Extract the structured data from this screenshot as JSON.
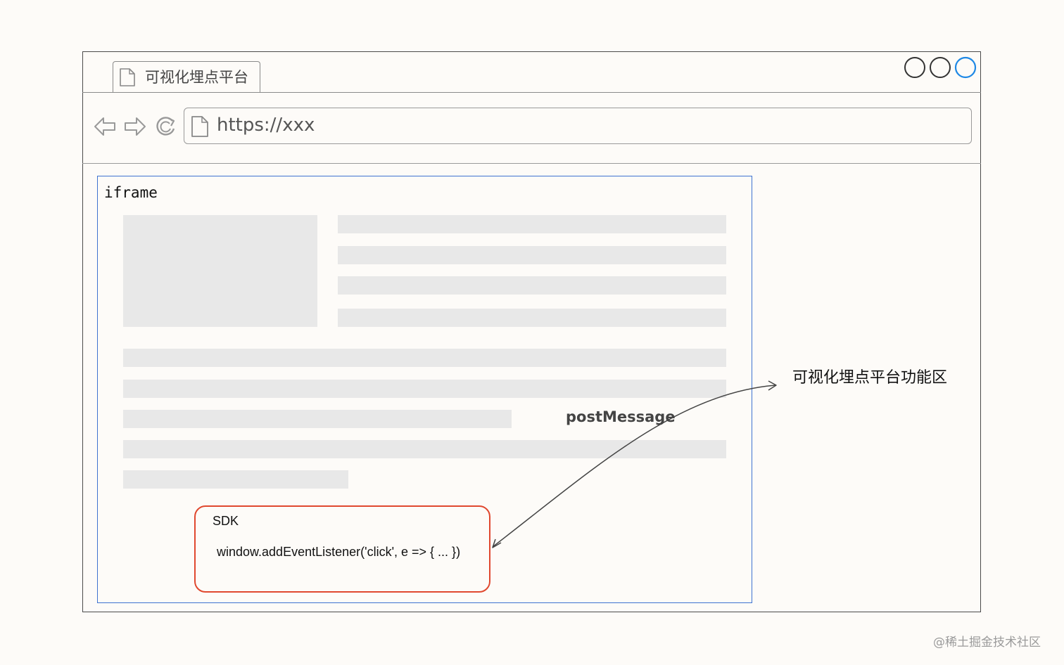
{
  "browser": {
    "tab_title": "可视化埋点平台",
    "url": "https://xxx",
    "icons": {
      "tab": "document-icon",
      "back": "back-arrow-icon",
      "forward": "forward-arrow-icon",
      "refresh": "refresh-icon",
      "address": "document-icon"
    },
    "window_buttons": [
      "circle",
      "circle",
      "circle"
    ]
  },
  "iframe": {
    "label": "iframe"
  },
  "sdk": {
    "title": "SDK",
    "code": "window.addEventListener('click', e => {  ...  })"
  },
  "connector": {
    "label": "postMessage"
  },
  "platform_area": {
    "label": "可视化埋点平台功能区"
  },
  "watermark": "@稀土掘金技术社区",
  "colors": {
    "iframe_border": "#3e72d0",
    "sdk_border": "#e0482f",
    "skeleton": "#e8e8e8",
    "active_window_button": "#1e88e5"
  }
}
